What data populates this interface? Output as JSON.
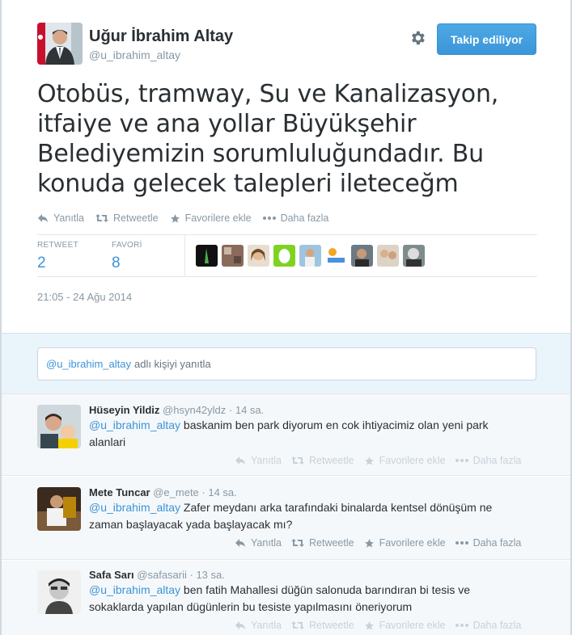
{
  "tweet": {
    "author_name": "Uğur İbrahim Altay",
    "author_handle": "@u_ibrahim_altay",
    "follow_label": "Takip ediliyor",
    "text": "Otobüs, tramway, Su ve Kanalizasyon, itfaiye ve ana yollar Büyükşehir Belediyemizin sorumluluğundadır. Bu konuda gelecek talepleri ileteceğm",
    "actions": {
      "reply": "Yanıtla",
      "retweet": "Retweetle",
      "favorite": "Favorilere ekle",
      "more": "Daha fazla"
    },
    "stats": {
      "retweet_label": "RETWEET",
      "retweet_count": "2",
      "favorite_label": "FAVORİ",
      "favorite_count": "8"
    },
    "timestamp": "21:05 - 24 Ağu 2014"
  },
  "reply_box": {
    "mention": "@u_ibrahim_altay",
    "placeholder": "adlı kişiyi yanıtla"
  },
  "replies": [
    {
      "name": "Hüseyin Yildiz",
      "handle": "@hsyn42yldz",
      "time": "· 14 sa.",
      "mention": "@u_ibrahim_altay",
      "text": " baskanim ben park diyorum en cok ihtiyacimiz olan yeni park alanlari"
    },
    {
      "name": "Mete Tuncar",
      "handle": "@e_mete",
      "time": "· 14 sa.",
      "mention": "@u_ibrahim_altay",
      "text": " Zafer meydanı arka tarafındaki binalarda kentsel dönüşüm ne zaman başlayacak yada başlayacak mı?"
    },
    {
      "name": "Safa Sarı",
      "handle": "@safasarii",
      "time": "· 13 sa.",
      "mention": "@u_ibrahim_altay",
      "text": " ben fatih Mahallesi düğün salonuda barındıran bi tesis ve sokaklarda yapılan dügünlerin bu tesiste yapılmasını öneriyorum"
    }
  ],
  "colors": {
    "accent": "#3b94d9",
    "follow_button": "#4ea8e6",
    "muted": "#8899a6",
    "reply_bg": "#eaf4fb"
  }
}
